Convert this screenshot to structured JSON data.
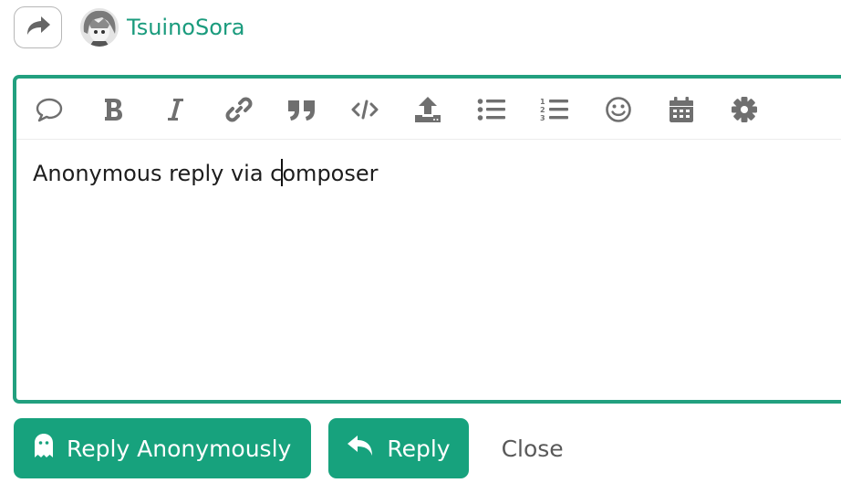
{
  "header": {
    "username": "TsuinoSora",
    "reply_to_icon": "share-arrow-icon",
    "avatar_icon": "user-avatar"
  },
  "toolbar": {
    "buttons": [
      {
        "icon": "speech-bubble-icon"
      },
      {
        "icon": "bold-icon"
      },
      {
        "icon": "italic-icon"
      },
      {
        "icon": "link-icon"
      },
      {
        "icon": "quote-icon"
      },
      {
        "icon": "code-icon"
      },
      {
        "icon": "upload-icon"
      },
      {
        "icon": "bullet-list-icon"
      },
      {
        "icon": "numbered-list-icon"
      },
      {
        "icon": "emoji-icon"
      },
      {
        "icon": "calendar-icon"
      },
      {
        "icon": "gear-icon"
      }
    ]
  },
  "editor": {
    "text_before_caret": "Anonymous reply via c",
    "text_after_caret": "omposer"
  },
  "footer": {
    "reply_anonymously_label": "Reply Anonymously",
    "reply_label": "Reply",
    "close_label": "Close"
  },
  "colors": {
    "accent": "#17a27d",
    "username": "#1a9b7d",
    "icon_gray": "#6f6f6f"
  }
}
